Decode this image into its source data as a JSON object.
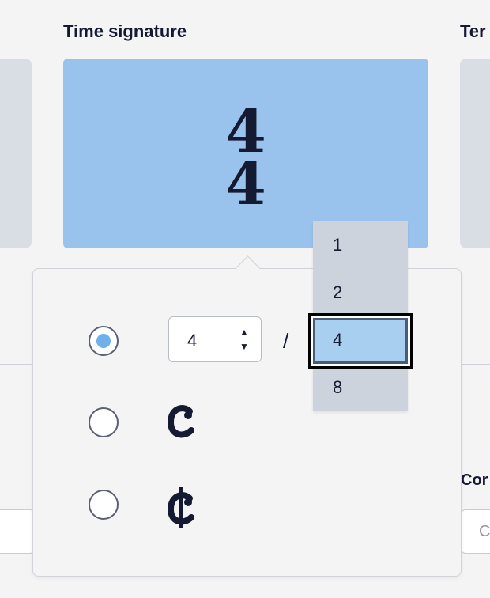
{
  "headings": {
    "time_signature": "Time signature",
    "tempo_partial": "Ter",
    "cor_partial": "Cor"
  },
  "preview": {
    "numerator": "4",
    "denominator": "4"
  },
  "ghost_input_text": "C",
  "popover": {
    "options": [
      {
        "id": "custom",
        "selected": true
      },
      {
        "id": "common-time",
        "symbol": "𝄴"
      },
      {
        "id": "cut-time",
        "symbol": "𝄵"
      }
    ],
    "numerator_value": "4",
    "slash": "/"
  },
  "denominator_dropdown": {
    "options": [
      "1",
      "2",
      "4",
      "8"
    ],
    "selected": "4"
  },
  "colors": {
    "accent": "#99c3ec",
    "selected_option": "#a9cff0",
    "radio_dot": "#6fb0ea"
  }
}
